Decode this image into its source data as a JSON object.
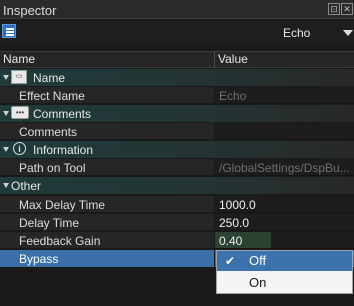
{
  "window": {
    "title": "Inspector",
    "pin_icon": "pin-icon",
    "close_icon": "close-icon"
  },
  "toolbar": {
    "category_icon": "categorized-view-icon",
    "selected_effect": "Echo"
  },
  "columns": {
    "name": "Name",
    "value": "Value"
  },
  "categories": [
    {
      "label": "Name",
      "icon": "name-tag-icon"
    },
    {
      "label": "Comments",
      "icon": "speech-bubble-icon"
    },
    {
      "label": "Information",
      "icon": "info-icon"
    },
    {
      "label": "Other"
    }
  ],
  "properties": [
    {
      "name": "Effect Name",
      "value": "Echo"
    },
    {
      "name": "Comments",
      "value": ""
    },
    {
      "name": "Path on Tool",
      "value": "/GlobalSettings/DspBu..."
    },
    {
      "name": "Max Delay Time",
      "value": "1000.0"
    },
    {
      "name": "Delay Time",
      "value": "250.0"
    },
    {
      "name": "Feedback Gain",
      "value": "0.40",
      "bar_fraction": 0.4
    },
    {
      "name": "Bypass",
      "value": "Off"
    }
  ],
  "bypass_dropdown": {
    "options": [
      "Off",
      "On"
    ],
    "selected": "Off"
  },
  "colors": {
    "selection": "#3b6fa8",
    "category_teal": "#1f3b3b",
    "accent_blue": "#2f6fbf"
  }
}
